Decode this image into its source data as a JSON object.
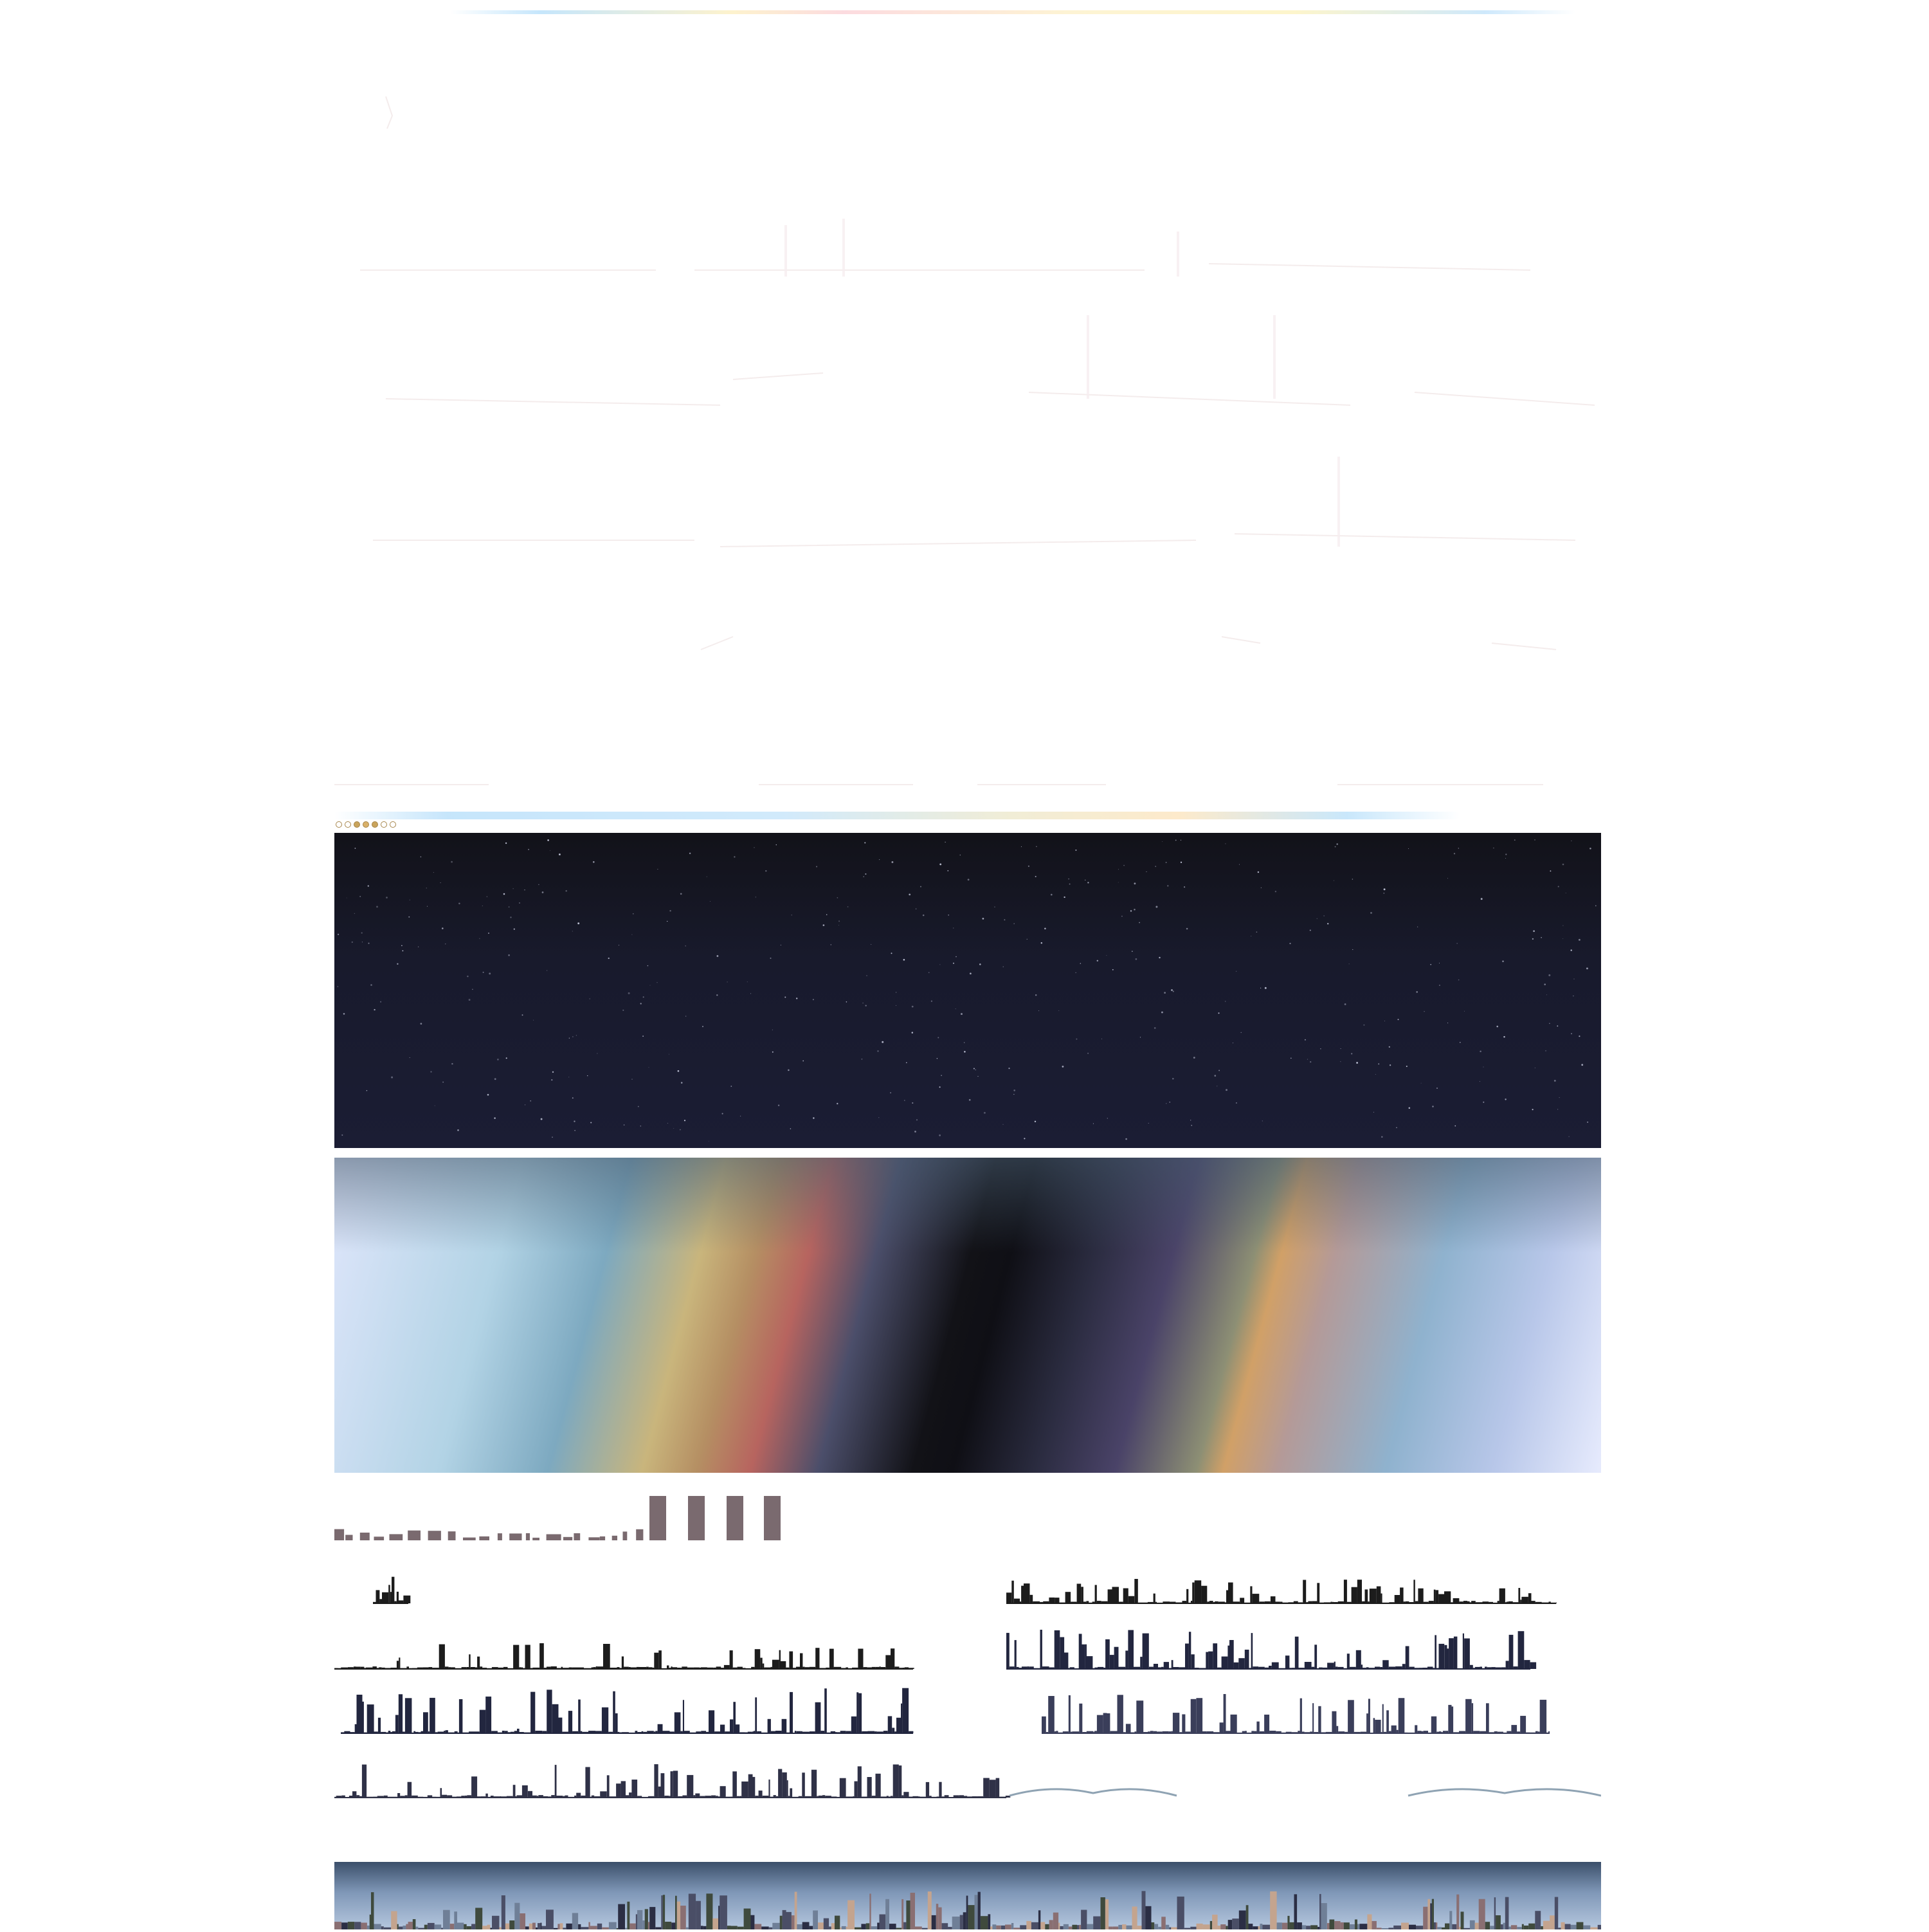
{
  "colors": {
    "night_top": "#121219",
    "night_bottom": "#1b1d34",
    "skyline_dark": "#1c1c1c",
    "skyline_navy": "#22263f",
    "bar_mauve": "#7a6a6f",
    "bridge_gray": "#8fa3b3"
  },
  "moon_phases": [
    "new-moon-icon",
    "waxing-crescent-icon",
    "first-quarter-icon",
    "waxing-gibbous-icon",
    "full-moon-icon",
    "waning-gibbous-icon",
    "last-quarter-icon",
    "waning-crescent-icon"
  ]
}
